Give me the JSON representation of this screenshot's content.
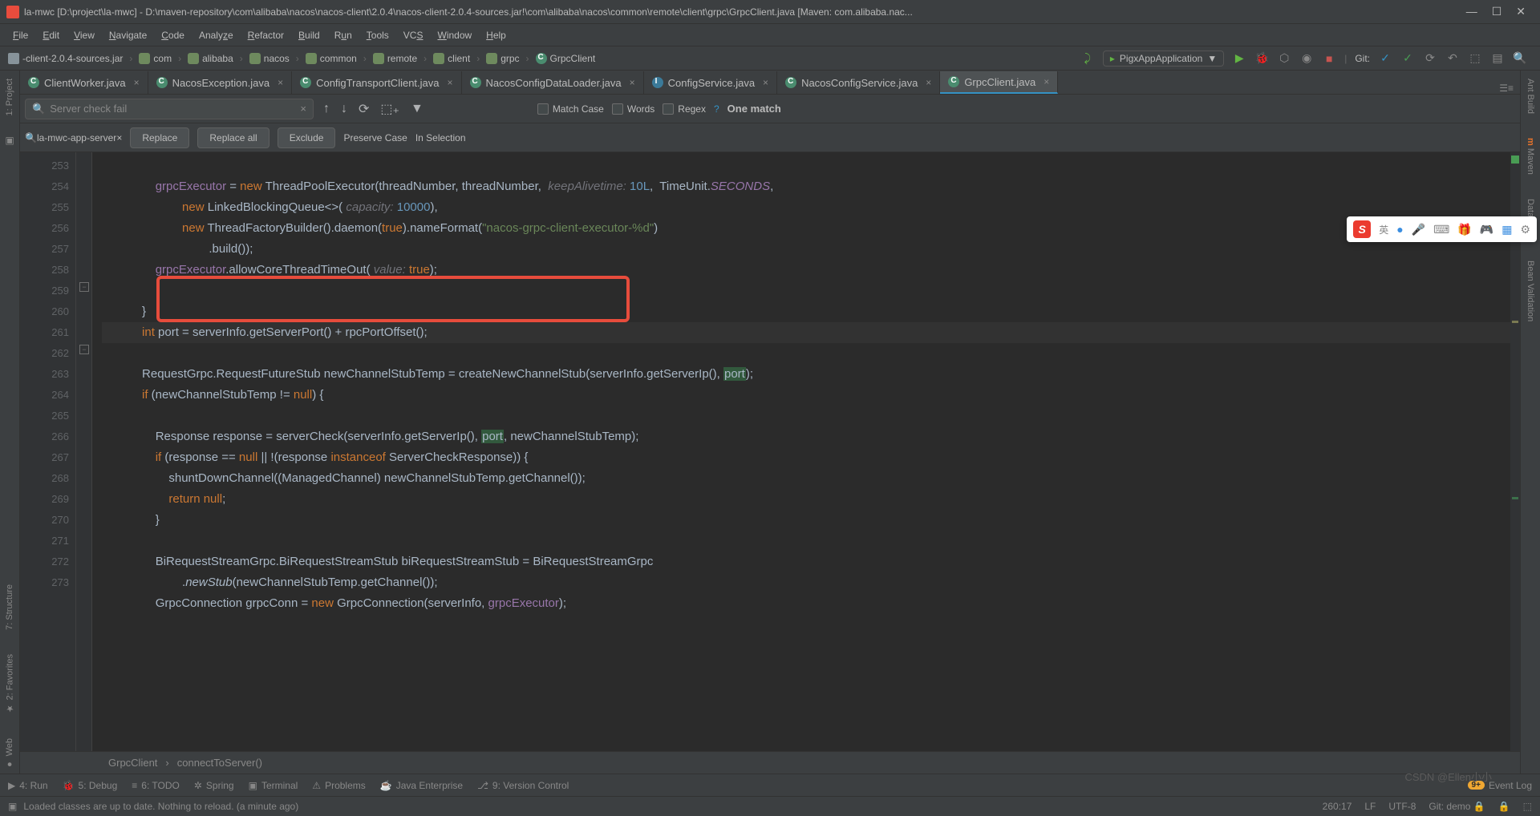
{
  "title": "la-mwc [D:\\project\\la-mwc] - D:\\maven-repository\\com\\alibaba\\nacos\\nacos-client\\2.0.4\\nacos-client-2.0.4-sources.jar!\\com\\alibaba\\nacos\\common\\remote\\client\\grpc\\GrpcClient.java [Maven: com.alibaba.nac...",
  "menu": [
    "File",
    "Edit",
    "View",
    "Navigate",
    "Code",
    "Analyze",
    "Refactor",
    "Build",
    "Run",
    "Tools",
    "VCS",
    "Window",
    "Help"
  ],
  "breadcrumb": [
    "-client-2.0.4-sources.jar",
    "com",
    "alibaba",
    "nacos",
    "common",
    "remote",
    "client",
    "grpc",
    "GrpcClient"
  ],
  "runconfig": "PigxAppApplication",
  "git_label": "Git:",
  "tabs": [
    {
      "name": "ClientWorker.java",
      "type": "cls"
    },
    {
      "name": "NacosException.java",
      "type": "cls"
    },
    {
      "name": "ConfigTransportClient.java",
      "type": "cls"
    },
    {
      "name": "NacosConfigDataLoader.java",
      "type": "cls"
    },
    {
      "name": "ConfigService.java",
      "type": "iface"
    },
    {
      "name": "NacosConfigService.java",
      "type": "cls"
    },
    {
      "name": "GrpcClient.java",
      "type": "cls",
      "active": true
    }
  ],
  "find": {
    "search_text": "Server check fail",
    "replace_text": "la-mwc-app-server",
    "match_case": "Match Case",
    "words": "Words",
    "regex": "Regex",
    "question": "?",
    "matches": "One match",
    "replace_btn": "Replace",
    "replace_all_btn": "Replace all",
    "exclude_btn": "Exclude",
    "preserve": "Preserve Case",
    "inselection": "In Selection"
  },
  "lines": {
    "253": "253",
    "254": "254",
    "255": "255",
    "256": "256",
    "257": "257",
    "258": "258",
    "259": "259",
    "260": "260",
    "261": "261",
    "262": "262",
    "263": "263",
    "264": "264",
    "265": "265",
    "266": "266",
    "267": "267",
    "268": "268",
    "269": "269",
    "270": "270",
    "271": "271",
    "272": "272",
    "273": "273"
  },
  "code": {
    "l253a": "grpcExecutor",
    "l253b": " = ",
    "l253c": "new",
    "l253d": " ThreadPoolExecutor(threadNumber, threadNumber,  ",
    "l253e": "keepAlivetime:",
    "l253f": " 10L",
    "l253g": ",  TimeUnit.",
    "l253h": "SECONDS",
    "l253i": ",",
    "l254a": "new",
    "l254b": " LinkedBlockingQueue<>( ",
    "l254c": "capacity:",
    "l254d": " 10000",
    "l254e": "),",
    "l255a": "new",
    "l255b": " ThreadFactoryBuilder().daemon(",
    "l255c": "true",
    "l255d": ").nameFormat(",
    "l255e": "\"nacos-grpc-client-executor-%d\"",
    "l255f": ")",
    "l256": ".build());",
    "l257a": "grpcExecutor",
    "l257b": ".allowCoreThreadTimeOut( ",
    "l257c": "value:",
    "l257d": " true",
    "l257e": ");",
    "l259": "}",
    "l260a": "int",
    "l260b": " port = serverInfo.getServerPort() + rpcPortOffset();",
    "l261a": "RequestGrpc.RequestFutureStub newChannelStubTemp = createNewChannelStub(serverInfo.getServerIp(), ",
    "l261b": "port",
    "l261c": ");",
    "l262a": "if",
    "l262b": " (newChannelStubTemp != ",
    "l262c": "null",
    "l262d": ") {",
    "l264a": "Response response = serverCheck(serverInfo.getServerIp(), ",
    "l264b": "port",
    "l264c": ", newChannelStubTemp);",
    "l265a": "if",
    "l265b": " (response == ",
    "l265c": "null",
    "l265d": " || !(response ",
    "l265e": "instanceof",
    "l265f": " ServerCheckResponse)) {",
    "l266": "shuntDownChannel((ManagedChannel) newChannelStubTemp.getChannel());",
    "l267a": "return",
    "l267b": " null",
    "l267c": ";",
    "l268": "}",
    "l270": "BiRequestStreamGrpc.BiRequestStreamStub biRequestStreamStub = BiRequestStreamGrpc",
    "l271a": ".",
    "l271b": "newStub",
    "l271c": "(newChannelStubTemp.getChannel());",
    "l272a": "GrpcConnection grpcConn = ",
    "l272b": "new",
    "l272c": " GrpcConnection(serverInfo, ",
    "l272d": "grpcExecutor",
    "l272e": ");"
  },
  "crumb": {
    "cls": "GrpcClient",
    "method": "connectToServer()",
    "sep": "›"
  },
  "bottom": {
    "run": "4: Run",
    "debug": "5: Debug",
    "todo": "6: TODO",
    "spring": "Spring",
    "terminal": "Terminal",
    "problems": "Problems",
    "javaee": "Java Enterprise",
    "vc": "9: Version Control",
    "eventlog": "Event Log",
    "badge": "9+"
  },
  "status": {
    "msg": "Loaded classes are up to date. Nothing to reload. (a minute ago)",
    "pos": "260:17",
    "le": "LF",
    "enc": "UTF-8",
    "git": "Git: demo",
    "lock": "🔒"
  },
  "ime": {
    "lang": "英"
  },
  "left": {
    "project": "1: Project",
    "structure": "7: Structure",
    "favorites": "2: Favorites",
    "web": "Web"
  },
  "right": {
    "ant": "Ant Build",
    "maven": "Maven",
    "db": "Database",
    "bean": "Bean Validation"
  },
  "watermark": "CSDN @Ellen小小"
}
